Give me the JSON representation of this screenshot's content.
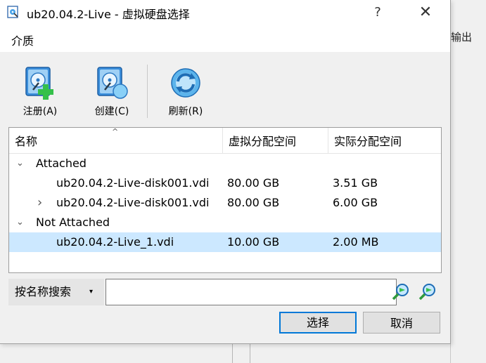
{
  "window": {
    "title": "ub20.04.2-Live - 虚拟硬盘选择",
    "help": "?",
    "close": "✕"
  },
  "background": {
    "label": "输出"
  },
  "menu": {
    "items": [
      "介质"
    ]
  },
  "toolbar": {
    "register_label": "注册(A)",
    "create_label": "创建(C)",
    "refresh_label": "刷新(R)"
  },
  "table": {
    "sort_indicator": "^",
    "columns": [
      "名称",
      "虚拟分配空间",
      "实际分配空间"
    ],
    "groups": [
      {
        "label": "Attached",
        "expand_icon": "⌄",
        "rows": [
          {
            "name": "ub20.04.2-Live-disk001.vdi",
            "virtual": "80.00 GB",
            "actual": "3.51 GB",
            "expander": ""
          },
          {
            "name": "ub20.04.2-Live-disk001.vdi",
            "virtual": "80.00 GB",
            "actual": "6.00 GB",
            "expander": "›"
          }
        ]
      },
      {
        "label": "Not Attached",
        "expand_icon": "⌄",
        "rows": [
          {
            "name": "ub20.04.2-Live_1.vdi",
            "virtual": "10.00 GB",
            "actual": "2.00 MB",
            "expander": "",
            "selected": true
          }
        ]
      }
    ]
  },
  "search": {
    "mode": "按名称搜索",
    "mode_caret": "▾",
    "value": "",
    "placeholder": ""
  },
  "buttons": {
    "select": "选择",
    "cancel": "取消"
  },
  "colors": {
    "selection": "#cce8ff",
    "focus_border": "#0078d7",
    "icon_blue": "#1a82d4",
    "icon_green": "#35c04a"
  }
}
